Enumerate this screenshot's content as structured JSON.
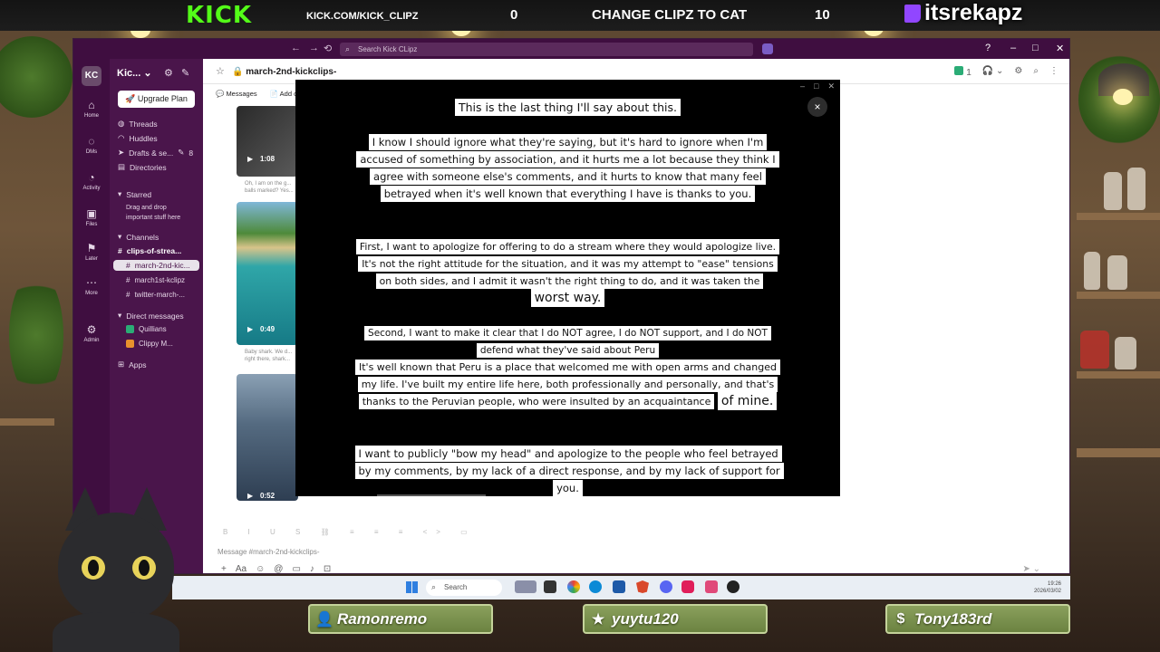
{
  "stream": {
    "logo": "KICK",
    "url": "KICK.COM/KICK_CLIPZ",
    "score_left": "0",
    "score_title": "CHANGE CLIPZ TO CAT",
    "score_right": "10",
    "twitch_handle": "itsrekapz"
  },
  "window": {
    "back": "←",
    "forward": "→",
    "history": "⟲",
    "search_placeholder": "Search Kick CLipz",
    "help": "?",
    "minimize": "–",
    "maximize": "□",
    "close": "✕"
  },
  "rail": {
    "workspace_badge": "KC",
    "items": [
      {
        "icon": "⌂",
        "label": "Home"
      },
      {
        "icon": "◌",
        "label": "DMs"
      },
      {
        "icon": "◔",
        "label": "Activity"
      },
      {
        "icon": "▣",
        "label": "Files"
      },
      {
        "icon": "⚑",
        "label": "Later"
      },
      {
        "icon": "⋯",
        "label": "More"
      },
      {
        "icon": "⚙",
        "label": "Admin"
      }
    ]
  },
  "sidebar": {
    "workspace_name": "Kic...",
    "upgrade_label": "Upgrade Plan",
    "threads": "Threads",
    "huddles": "Huddles",
    "drafts": "Drafts & se...",
    "drafts_count": "8",
    "directories": "Directories",
    "starred": "Starred",
    "starred_hint_1": "Drag and drop",
    "starred_hint_2": "important stuff here",
    "channels_header": "Channels",
    "channels": [
      "clips-of-strea...",
      "march-2nd-kic...",
      "march1st-kclipz",
      "twitter-march-..."
    ],
    "dm_header": "Direct messages",
    "dms": [
      "Quillians",
      "Clippy M..."
    ],
    "apps": "Apps"
  },
  "channel": {
    "name": "march-2nd-kickclips-",
    "tab_messages": "Messages",
    "tab_add": "Add c",
    "member_count": "1",
    "composer_placeholder": "Message #march-2nd-kickclips-"
  },
  "clips": [
    {
      "duration": "1:08",
      "caption": "Oh, I am on the g... balls marked? Yes..."
    },
    {
      "duration": "0:49",
      "caption": "Baby shark. We d... right there, shark..."
    },
    {
      "duration": "0:52",
      "caption": ""
    }
  ],
  "video": {
    "close": "×",
    "p1": "This is the last thing I'll say about this.",
    "p2": "I know I should ignore what they're saying, but it's hard to ignore when I'm accused of something by association, and it hurts me a lot because they think I agree with someone else's comments, and it hurts to know that many feel betrayed when it's well known that everything I have is thanks to you.",
    "p3_main": "First, I want to apologize for offering to do a stream where they would apologize live. It's not the right attitude for the situation, and it was my attempt to \"ease\" tensions on both sides, and I admit it wasn't the right thing to do, and it was taken the",
    "p3_big": "worst way.",
    "p4": "Second, I want to make it clear that I do NOT agree, I do NOT support, and I do NOT defend what they've said about Peru",
    "p5_main": "It's well known that Peru is a place that welcomed me with open arms and changed my life. I've built my entire life here, both professionally and personally, and that's thanks to the Peruvian people, who were insulted by an acquaintance",
    "p5_big": "of mine.",
    "p6": "I want to publicly \"bow my head\" and apologize to the people who feel betrayed by my comments, by my lack of a direct response, and by my lack of support for you."
  },
  "taskbar": {
    "search": "Search",
    "time": "19:26",
    "date": "2026/03/02"
  },
  "chatters": [
    {
      "icon": "👤",
      "name": "Ramonremo"
    },
    {
      "icon": "★",
      "name": "yuytu120"
    },
    {
      "icon": "$",
      "name": "Tony183rd"
    }
  ]
}
